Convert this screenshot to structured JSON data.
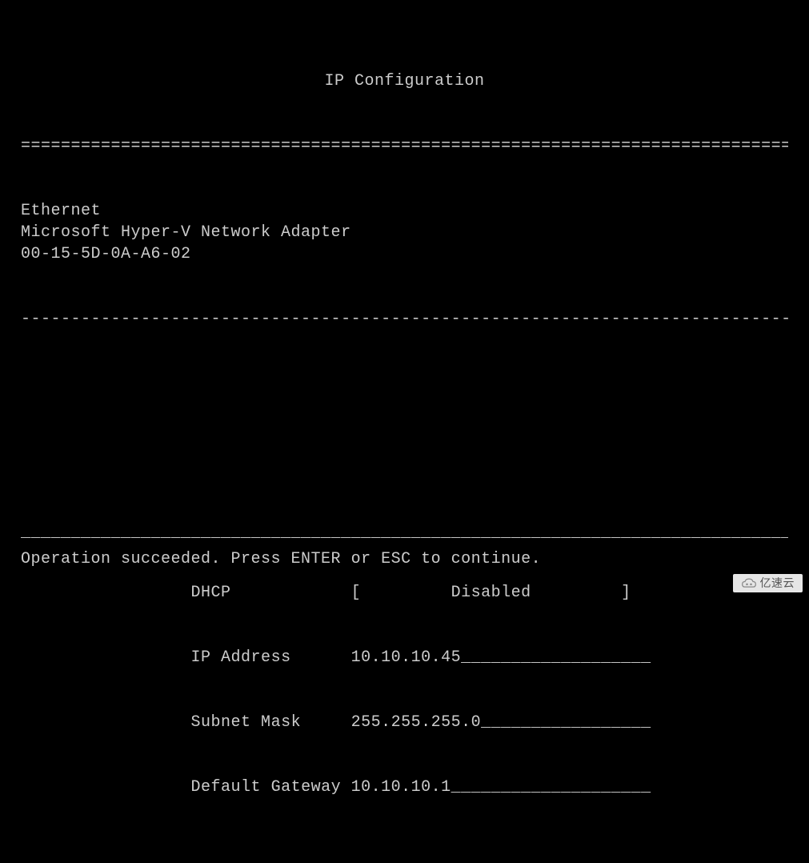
{
  "title": "IP Configuration",
  "divider_double": "================================================================================",
  "adapter": {
    "type": "Ethernet",
    "name": "Microsoft Hyper-V Network Adapter",
    "mac": "00-15-5D-0A-A6-02"
  },
  "divider_single": "--------------------------------------------------------------------------------",
  "config": {
    "dhcp": {
      "label": "DHCP",
      "value": "Disabled"
    },
    "ip_address": {
      "label": "IP Address",
      "value": "10.10.10.45"
    },
    "subnet_mask": {
      "label": "Subnet Mask",
      "value": "255.255.255.0"
    },
    "default_gateway": {
      "label": "Default Gateway",
      "value": "10.10.10.1"
    }
  },
  "divider_bottom": "________________________________________________________________________________",
  "status": "Operation succeeded. Press ENTER or ESC to continue.",
  "watermark": "亿速云"
}
